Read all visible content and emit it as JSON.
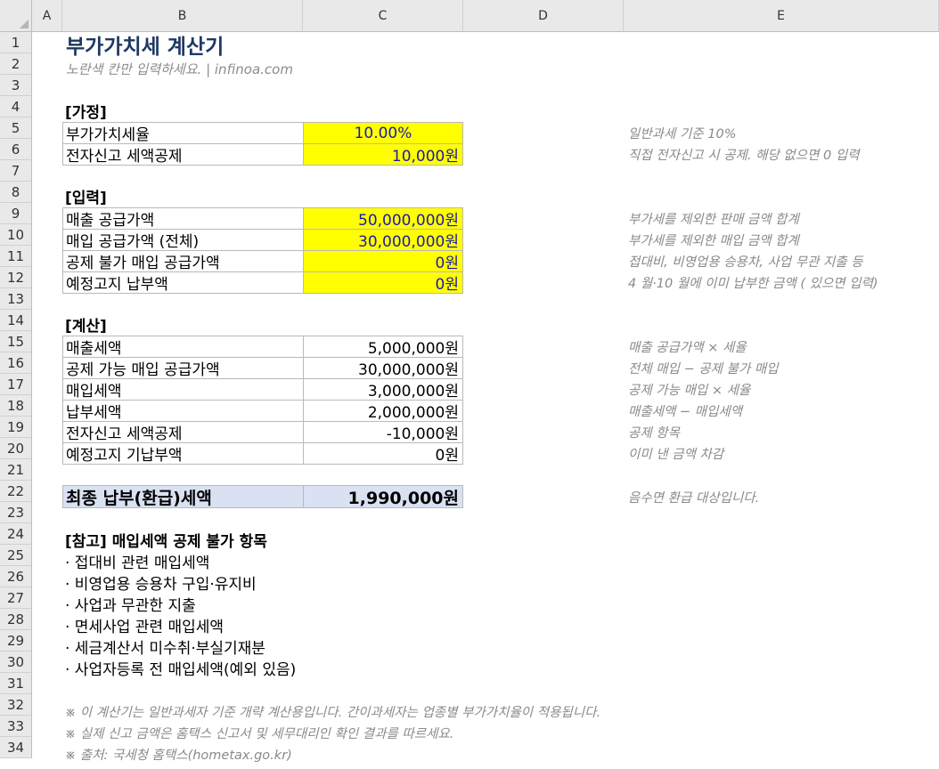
{
  "columns": [
    "A",
    "B",
    "C",
    "D",
    "E"
  ],
  "rows": [
    "1",
    "2",
    "3",
    "4",
    "5",
    "6",
    "7",
    "8",
    "9",
    "10",
    "11",
    "12",
    "13",
    "14",
    "15",
    "16",
    "17",
    "18",
    "19",
    "20",
    "21",
    "22",
    "23",
    "24",
    "25",
    "26",
    "27",
    "28",
    "29",
    "30",
    "31",
    "32",
    "33",
    "34"
  ],
  "title": "부가가치세 계산기",
  "subtitle": "노란색 칸만 입력하세요.  |  infinoa.com",
  "assumptions": {
    "header": "[가정]",
    "rows": [
      {
        "label": "부가가치세율",
        "value": "10.00%",
        "note": "일반과세 기준 10%"
      },
      {
        "label": "전자신고 세액공제",
        "value": "10,000원",
        "note": "직접 전자신고 시 공제. 해당 없으면 0  입력"
      }
    ]
  },
  "inputs": {
    "header": "[입력]",
    "rows": [
      {
        "label": "매출 공급가액",
        "value": "50,000,000원",
        "note": "부가세를 제외한 판매 금액 합계"
      },
      {
        "label": "매입 공급가액 (전체)",
        "value": "30,000,000원",
        "note": "부가세를 제외한 매입 금액 합계"
      },
      {
        "label": "공제 불가 매입 공급가액",
        "value": "0원",
        "note": "접대비, 비영업용 승용차, 사업 무관 지출 등"
      },
      {
        "label": "예정고지 납부액",
        "value": "0원",
        "note": "4 월·10 월에 이미 납부한 금액 ( 있으면 입력)"
      }
    ]
  },
  "calc": {
    "header": "[계산]",
    "rows": [
      {
        "label": "매출세액",
        "value": "5,000,000원",
        "note": "매출 공급가액 × 세율"
      },
      {
        "label": "공제 가능 매입 공급가액",
        "value": "30,000,000원",
        "note": "전체 매입 − 공제 불가 매입"
      },
      {
        "label": "매입세액",
        "value": "3,000,000원",
        "note": "공제 가능 매입 × 세율"
      },
      {
        "label": "납부세액",
        "value": "2,000,000원",
        "note": "매출세액 − 매입세액"
      },
      {
        "label": "전자신고 세액공제",
        "value": "-10,000원",
        "note": "공제 항목"
      },
      {
        "label": "예정고지 기납부액",
        "value": "0원",
        "note": "이미 낸 금액 차감"
      }
    ]
  },
  "final": {
    "label": "최종 납부(환급)세액",
    "value": "1,990,000원",
    "note": "음수면 환급 대상입니다."
  },
  "reference": {
    "header": "[참고] 매입세액 공제 불가 항목",
    "items": [
      "· 접대비 관련 매입세액",
      "· 비영업용 승용차 구입·유지비",
      "· 사업과 무관한 지출",
      "· 면세사업 관련 매입세액",
      "· 세금계산서 미수취·부실기재분",
      "· 사업자등록 전 매입세액(예외 있음)"
    ]
  },
  "footnotes": [
    "※ 이 계산기는 일반과세자 기준 개략 계산용입니다. 간이과세자는 업종별 부가가치율이 적용됩니다.",
    "※ 실제 신고 금액은 홈택스 신고서 및 세무대리인 확인 결과를 따르세요.",
    "※ 출처: 국세청 홈택스(hometax.go.kr)"
  ]
}
